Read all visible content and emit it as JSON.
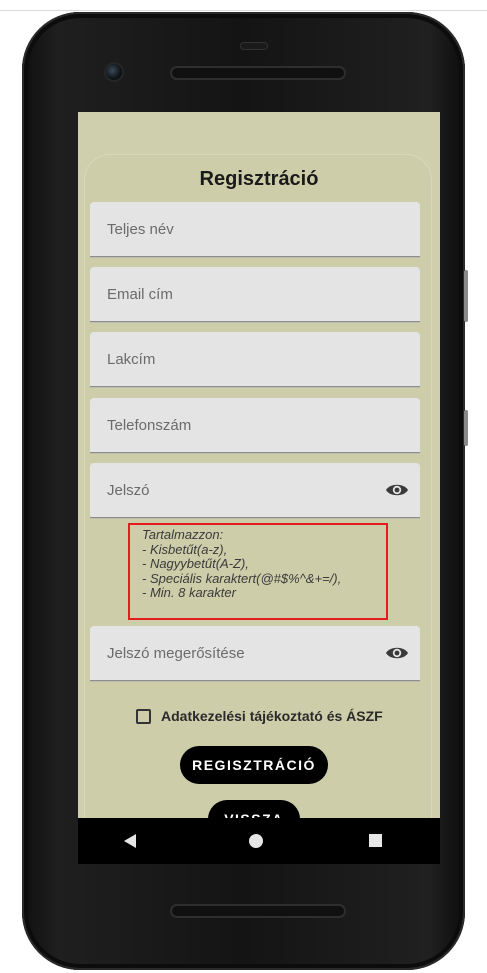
{
  "form": {
    "title": "Regisztráció",
    "fields": {
      "full_name": {
        "placeholder": "Teljes név"
      },
      "email": {
        "placeholder": "Email cím"
      },
      "address": {
        "placeholder": "Lakcím"
      },
      "phone": {
        "placeholder": "Telefonszám"
      },
      "password": {
        "placeholder": "Jelszó",
        "icon": "eye-icon"
      },
      "password_confirm": {
        "placeholder": "Jelszó megerősítése",
        "icon": "eye-icon"
      }
    },
    "password_hint": [
      "Tartalmazzon:",
      "- Kisbetűt(a-z),",
      "- Nagyybetűt(A-Z),",
      "- Speciális karaktert(@#$%^&+=/),",
      "- Min. 8 karakter"
    ],
    "terms_checkbox": {
      "label": "Adatkezelési tájékoztató és ÁSZF",
      "checked": false
    },
    "register_button": "REGISZTRÁCIÓ",
    "back_button": "VISSZA"
  },
  "navbar": {
    "back_icon": "back-triangle-icon",
    "home_icon": "home-circle-icon",
    "recents_icon": "recents-square-icon"
  },
  "colors": {
    "screen_background": "#cfcfae",
    "field_background": "#e4e4e4",
    "hint_border": "#e11d1d",
    "button_background": "#000000"
  }
}
